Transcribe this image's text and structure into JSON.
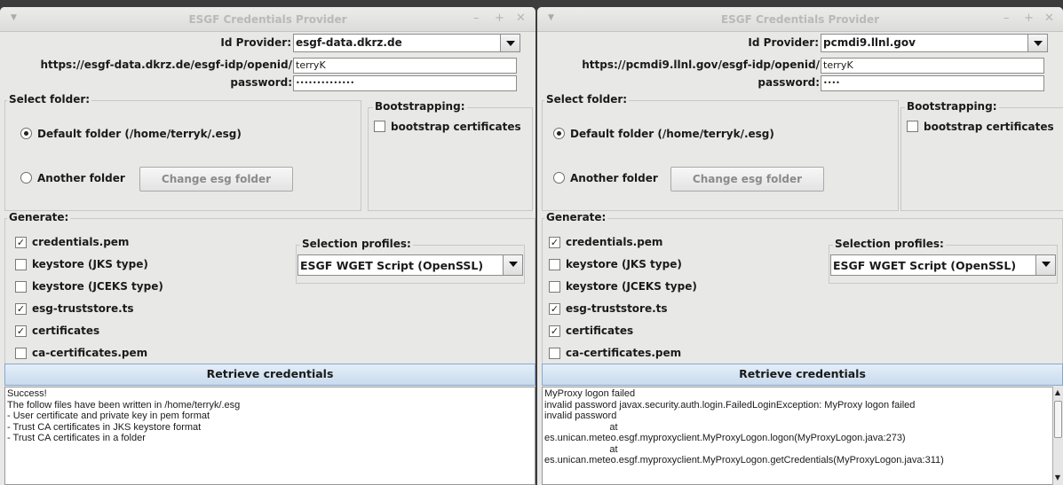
{
  "windows": [
    {
      "title": "ESGF Credentials Provider",
      "id_provider_label": "Id Provider:",
      "id_provider_value": "esgf-data.dkrz.de",
      "openid_prefix": "https://esgf-data.dkrz.de/esgf-idp/openid/",
      "username": "terryK",
      "password_label": "password:",
      "password_mask": "••••••••••••••",
      "select_folder_title": "Select folder:",
      "default_folder_label": "Default folder (/home/terryk/.esg)",
      "another_folder_label": "Another folder",
      "change_folder_button": "Change esg folder",
      "bootstrapping_title": "Bootstrapping:",
      "bootstrap_label": "bootstrap certificates",
      "generate_title": "Generate:",
      "options": [
        {
          "label": "credentials.pem",
          "checked": true,
          "mark": "✓"
        },
        {
          "label": "keystore (JKS type)",
          "checked": false,
          "mark": ""
        },
        {
          "label": "keystore (JCEKS type)",
          "checked": false,
          "mark": ""
        },
        {
          "label": "esg-truststore.ts",
          "checked": true,
          "mark": "✓"
        },
        {
          "label": "certificates",
          "checked": true,
          "mark": "✓"
        },
        {
          "label": "ca-certificates.pem",
          "checked": false,
          "mark": ""
        }
      ],
      "selection_profiles_title": "Selection profiles:",
      "selection_profile_value": "ESGF WGET Script (OpenSSL)",
      "retrieve_button": "Retrieve credentials",
      "output_lines": [
        "Success!",
        "The follow files have been written in /home/terryk/.esg",
        "- User certificate and private key in pem format",
        "- Trust CA certificates in JKS keystore format",
        "- Trust CA certificates in a folder"
      ]
    },
    {
      "title": "ESGF Credentials Provider",
      "id_provider_label": "Id Provider:",
      "id_provider_value": "pcmdi9.llnl.gov",
      "openid_prefix": "https://pcmdi9.llnl.gov/esgf-idp/openid/",
      "username": "terryK",
      "password_label": "password:",
      "password_mask": "••••",
      "select_folder_title": "Select folder:",
      "default_folder_label": "Default folder (/home/terryk/.esg)",
      "another_folder_label": "Another folder",
      "change_folder_button": "Change esg folder",
      "bootstrapping_title": "Bootstrapping:",
      "bootstrap_label": "bootstrap certificates",
      "generate_title": "Generate:",
      "options": [
        {
          "label": "credentials.pem",
          "checked": true,
          "mark": "✓"
        },
        {
          "label": "keystore (JKS type)",
          "checked": false,
          "mark": ""
        },
        {
          "label": "keystore (JCEKS type)",
          "checked": false,
          "mark": ""
        },
        {
          "label": "esg-truststore.ts",
          "checked": true,
          "mark": "✓"
        },
        {
          "label": "certificates",
          "checked": true,
          "mark": "✓"
        },
        {
          "label": "ca-certificates.pem",
          "checked": false,
          "mark": ""
        }
      ],
      "selection_profiles_title": "Selection profiles:",
      "selection_profile_value": "ESGF WGET Script (OpenSSL)",
      "retrieve_button": "Retrieve credentials",
      "output_lines": [
        "MyProxy logon failed",
        "invalid password javax.security.auth.login.FailedLoginException: MyProxy logon failed",
        "invalid password",
        "                        at",
        "es.unican.meteo.esgf.myproxyclient.MyProxyLogon.logon(MyProxyLogon.java:273)",
        "                        at",
        "es.unican.meteo.esgf.myproxyclient.MyProxyLogon.getCredentials(MyProxyLogon.java:311)"
      ]
    }
  ]
}
